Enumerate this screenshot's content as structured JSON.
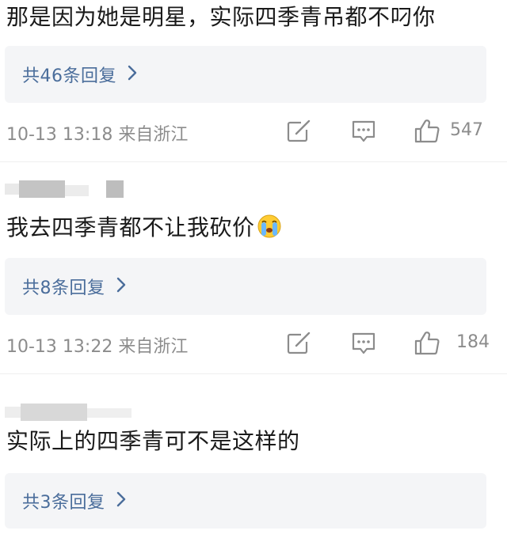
{
  "comments": [
    {
      "text": "那是因为她是明星，实际四季青吊都不叼你",
      "reply_label": "共46条回复",
      "meta": "10-13 13:18  来自浙江",
      "likes": "547"
    },
    {
      "text": "我去四季青都不让我砍价",
      "reply_label": "共8条回复",
      "meta": "10-13 13:22  来自浙江",
      "likes": "184",
      "emoji": "crying-face-icon"
    },
    {
      "text": "实际上的四季青可不是这样的",
      "reply_label": "共3条回复"
    }
  ],
  "colors": {
    "reply_link": "#4a6d9b",
    "meta_gray": "#8c8c8c",
    "reply_bg": "#f4f5f7"
  },
  "icons": [
    "edit-icon",
    "comment-icon",
    "thumbs-up-icon",
    "chevron-right-icon",
    "crying-face-icon"
  ]
}
